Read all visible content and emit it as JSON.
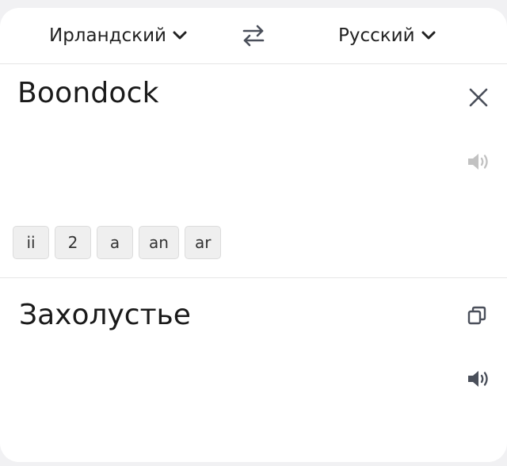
{
  "languages": {
    "source": "Ирландский",
    "target": "Русский"
  },
  "icons": {
    "chevron": "chevron-down-icon",
    "swap": "swap-arrows-icon",
    "clear": "close-icon",
    "speaker": "speaker-icon",
    "copy": "copy-icon"
  },
  "source": {
    "text": "Boondock",
    "suggestions": [
      "ii",
      "2",
      "a",
      "an",
      "ar"
    ]
  },
  "translation": {
    "text": "Захолустье"
  },
  "colors": {
    "icon_dark": "#4a4f5a",
    "icon_light": "#c2c2c2",
    "divider": "#e6e6e6",
    "chip_bg": "#efefef"
  }
}
